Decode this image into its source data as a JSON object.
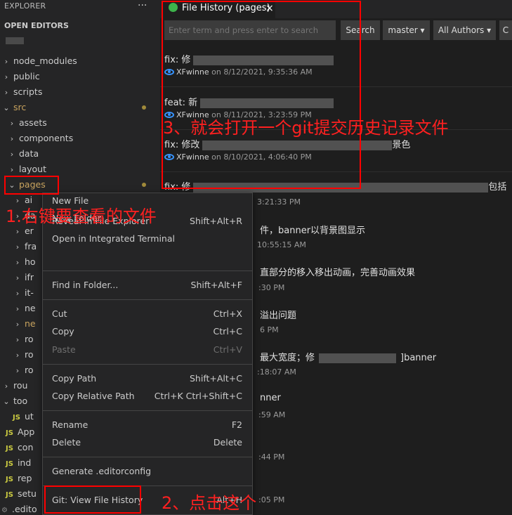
{
  "sidebar": {
    "header": "EXPLORER",
    "more": "···",
    "open_editors": "OPEN EDITORS",
    "tree": [
      {
        "label": "node_modules",
        "chev": "›"
      },
      {
        "label": "public",
        "chev": "›"
      },
      {
        "label": "scripts",
        "chev": "›"
      },
      {
        "label": "src",
        "chev": "⌄"
      },
      {
        "label": "assets",
        "chev": "›"
      },
      {
        "label": "components",
        "chev": "›"
      },
      {
        "label": "data",
        "chev": "›"
      },
      {
        "label": "layout",
        "chev": "›"
      },
      {
        "label": "pages",
        "chev": "⌄"
      },
      {
        "label": "ai",
        "chev": "›"
      },
      {
        "label": "da",
        "chev": "›"
      },
      {
        "label": "er",
        "chev": "›"
      },
      {
        "label": "fra",
        "chev": "›"
      },
      {
        "label": "ho",
        "chev": "›"
      },
      {
        "label": "ifr",
        "chev": "›"
      },
      {
        "label": "it-",
        "chev": "›"
      },
      {
        "label": "ne",
        "chev": "›"
      },
      {
        "label": "ne",
        "chev": "›"
      },
      {
        "label": "ro",
        "chev": "›"
      },
      {
        "label": "ro",
        "chev": "›"
      },
      {
        "label": "ro",
        "chev": "›"
      },
      {
        "label": "rou",
        "chev": "›"
      },
      {
        "label": "too",
        "chev": "⌄"
      },
      {
        "label": "ut",
        "js": "JS"
      },
      {
        "label": "App",
        "js": "JS"
      },
      {
        "label": "con",
        "js": "JS"
      },
      {
        "label": "ind",
        "js": "JS"
      },
      {
        "label": "rep",
        "js": "JS"
      },
      {
        "label": "setu",
        "js": "JS"
      },
      {
        "label": ".edito"
      }
    ]
  },
  "tab": {
    "title": "File History (pages)",
    "close": "×"
  },
  "search": {
    "placeholder": "Enter term and press enter to search"
  },
  "toolbar": {
    "search": "Search",
    "branch": "master ▾",
    "authors": "All Authors ▾",
    "more": "C"
  },
  "commits": [
    {
      "msg": "fix: 修",
      "author": "XFwinne",
      "date": " on 8/12/2021, 9:35:36 AM"
    },
    {
      "msg": "feat: 新",
      "author": "XFwinne",
      "date": " on 8/11/2021, 3:23:59 PM"
    },
    {
      "msg": "fix: 修改",
      "tail": "景色",
      "author": "XFwinne",
      "date": " on 8/10/2021, 4:06:40 PM"
    },
    {
      "msg": "fix: 修",
      "tail": "包括"
    }
  ],
  "partial": {
    "t1": "3:21:33 PM",
    "m2": "件，banner以背景图显示",
    "t2": "10:55:15 AM",
    "m3": "直部分的移入移出动画，完善动画效果",
    "t3": ":30 PM",
    "m4": "溢出问题",
    "t4": "6 PM",
    "m5": "最大宽度；修",
    "m5b": "]banner",
    "t5": ":18:07 AM",
    "m6": "nner",
    "t6": ":59 AM",
    "t7": ":44 PM",
    "t8": ":05 PM"
  },
  "menu": {
    "new_file": "New File",
    "new_folder": "New Folder",
    "reveal": "Reveal in File Explorer",
    "reveal_key": "Shift+Alt+R",
    "terminal": "Open in Integrated Terminal",
    "find": "Find in Folder...",
    "find_key": "Shift+Alt+F",
    "cut": "Cut",
    "cut_key": "Ctrl+X",
    "copy": "Copy",
    "copy_key": "Ctrl+C",
    "paste": "Paste",
    "paste_key": "Ctrl+V",
    "copy_path": "Copy Path",
    "copy_path_key": "Shift+Alt+C",
    "copy_rel": "Copy Relative Path",
    "copy_rel_key": "Ctrl+K Ctrl+Shift+C",
    "rename": "Rename",
    "rename_key": "F2",
    "delete": "Delete",
    "delete_key": "Delete",
    "editorconfig": "Generate .editorconfig",
    "git_history": "Git: View File History",
    "git_history_key": "Alt+H"
  },
  "annotations": {
    "step1": "1.右键要查看的文件",
    "step2": "2、点击这个",
    "step3": "3、就会打开一个git提交历史记录文件"
  },
  "colors": {
    "accent": "#3794ff",
    "annotation": "#ff0000",
    "folder_modified": "#c8a35e"
  }
}
